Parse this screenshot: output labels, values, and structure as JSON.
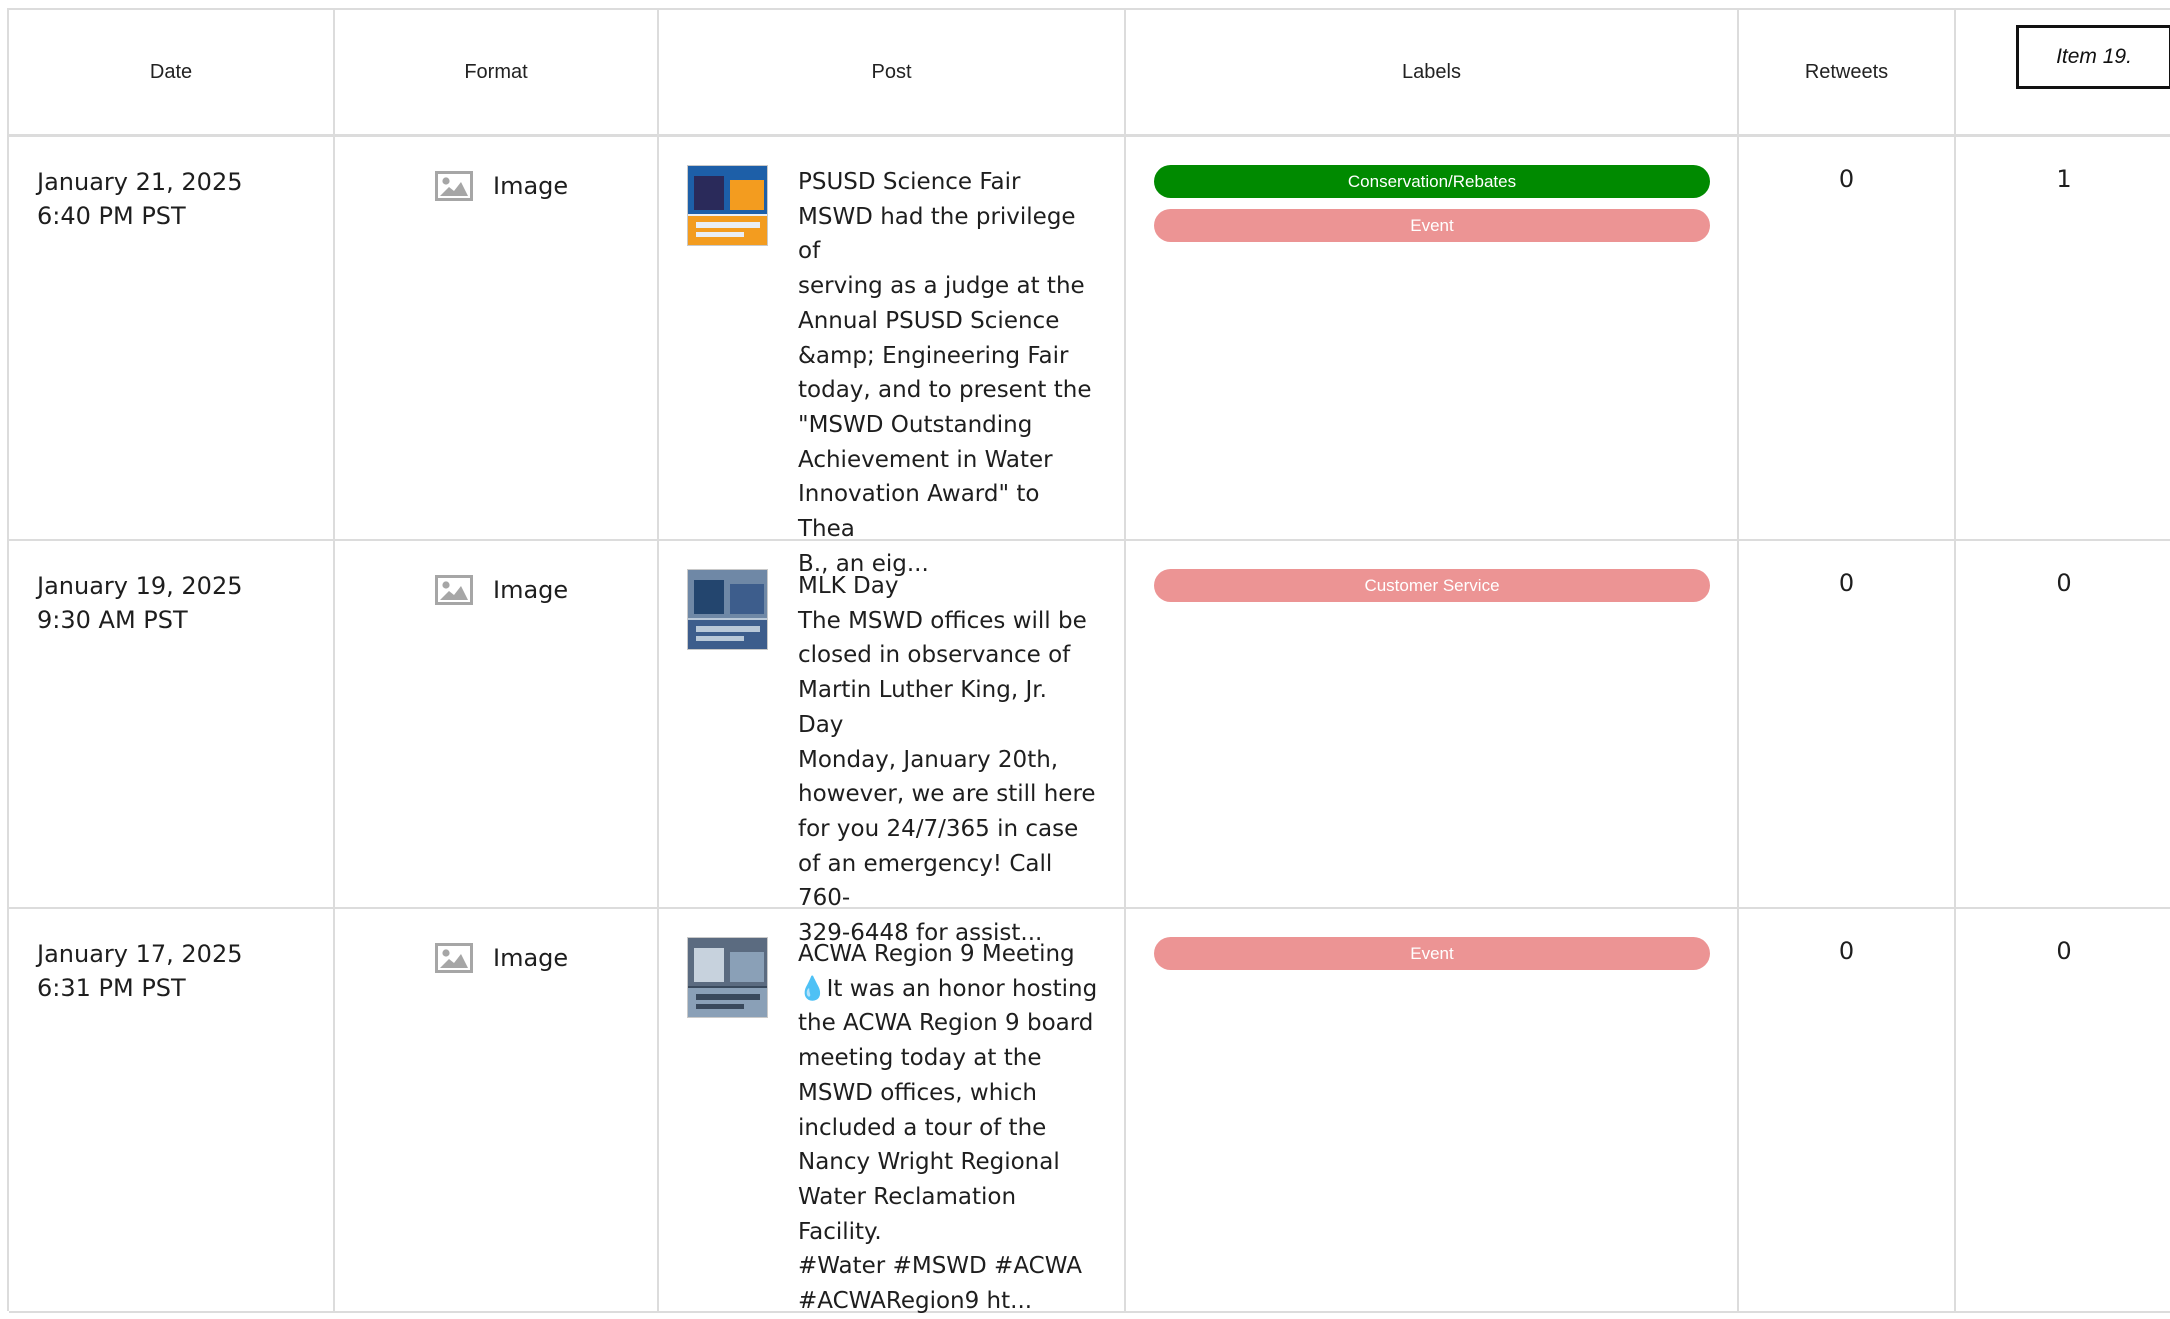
{
  "header": {
    "date": "Date",
    "format": "Format",
    "post": "Post",
    "labels": "Labels",
    "retweets": "Retweets",
    "item_tag": "Item 19."
  },
  "colors": {
    "conservation": "#008a00",
    "pink": "#ec9494",
    "border": "#dcdcdc"
  },
  "rows": [
    {
      "date": "January 21, 2025",
      "time": "6:40 PM PST",
      "format": "Image",
      "post_lines": [
        "PSUSD Science Fair",
        "MSWD had the privilege of",
        "serving as a judge at the",
        "Annual PSUSD Science",
        "&amp; Engineering Fair",
        "today, and to present the",
        "\"MSWD Outstanding",
        "Achievement in Water",
        "Innovation Award\" to Thea",
        "B., an eig..."
      ],
      "labels": [
        {
          "text": "Conservation/Rebates",
          "color": "#008a00"
        },
        {
          "text": "Event",
          "color": "#ec9494"
        }
      ],
      "retweets": "0",
      "likes": "1"
    },
    {
      "date": "January 19, 2025",
      "time": "9:30 AM PST",
      "format": "Image",
      "post_lines": [
        "MLK Day",
        "The MSWD offices will be",
        "closed in observance of",
        "Martin Luther King, Jr. Day",
        "Monday, January 20th,",
        "however, we are still here",
        "for you 24/7/365 in case",
        "of an emergency! Call 760-",
        "329-6448 for assist..."
      ],
      "labels": [
        {
          "text": "Customer Service",
          "color": "#ec9494"
        }
      ],
      "retweets": "0",
      "likes": "0"
    },
    {
      "date": "January 17, 2025",
      "time": "6:31 PM PST",
      "format": "Image",
      "post_lines": [
        "ACWA Region 9 Meeting",
        "💧It was an honor hosting",
        "the ACWA Region 9 board",
        "meeting today at the",
        "MSWD offices, which",
        "included a tour of the",
        "Nancy Wright Regional",
        "Water Reclamation Facility.",
        "#Water #MSWD #ACWA",
        "#ACWARegion9 ht..."
      ],
      "labels": [
        {
          "text": "Event",
          "color": "#ec9494"
        }
      ],
      "retweets": "0",
      "likes": "0"
    }
  ]
}
